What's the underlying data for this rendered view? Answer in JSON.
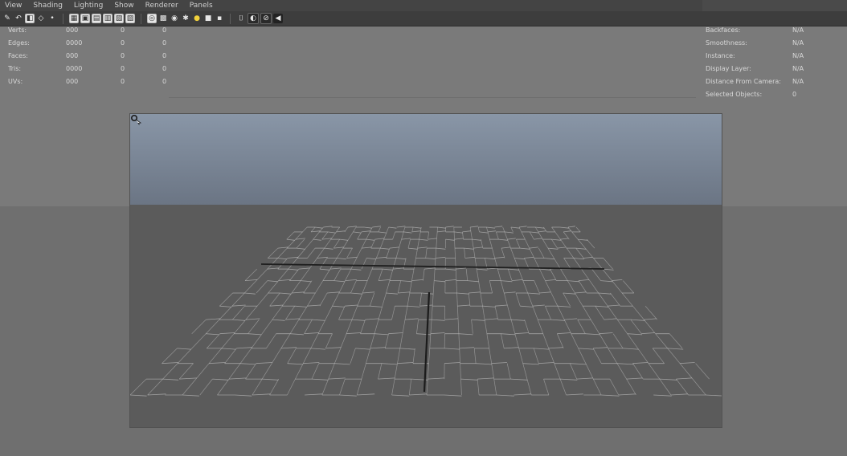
{
  "menu": {
    "items": [
      "View",
      "Shading",
      "Lighting",
      "Show",
      "Renderer",
      "Panels"
    ]
  },
  "toolbar": {
    "icons": [
      "select-camera-icon",
      "undo-view-icon",
      "bookmark-icon",
      "camera-attr-icon",
      "dot-icon",
      "grid-icon",
      "film-gate-icon",
      "resolution-gate-icon",
      "gate-mask-icon",
      "field-chart-icon",
      "safe-action-icon",
      "wireframe-icon",
      "smooth-shade-icon",
      "textured-icon",
      "default-light-icon",
      "shadows-icon",
      "ambient-occlusion-icon",
      "xray-icon",
      "isolate-icon",
      "motion-blur-icon",
      "antialias-icon"
    ]
  },
  "hud": {
    "rows": [
      {
        "label": "Verts:",
        "value": "000",
        "c2": "0",
        "c3": "0"
      },
      {
        "label": "Edges:",
        "value": "0000",
        "c2": "0",
        "c3": "0"
      },
      {
        "label": "Faces:",
        "value": "000",
        "c2": "0",
        "c3": "0"
      },
      {
        "label": "Tris:",
        "value": "0000",
        "c2": "0",
        "c3": "0"
      },
      {
        "label": "UVs:",
        "value": "000",
        "c2": "0",
        "c3": "0"
      }
    ],
    "right": [
      {
        "label": "Backfaces:",
        "value": "N/A"
      },
      {
        "label": "Smoothness:",
        "value": "N/A"
      },
      {
        "label": "Instance:",
        "value": "N/A"
      },
      {
        "label": "Display Layer:",
        "value": "N/A"
      },
      {
        "label": "Distance From Camera:",
        "value": "N/A"
      },
      {
        "label": "Selected Objects:",
        "value": "0"
      }
    ]
  },
  "viewport": {
    "sky_color": "#7e8a9b",
    "ground_color": "#5b5b5b",
    "line_color": "#d8d8d8"
  }
}
